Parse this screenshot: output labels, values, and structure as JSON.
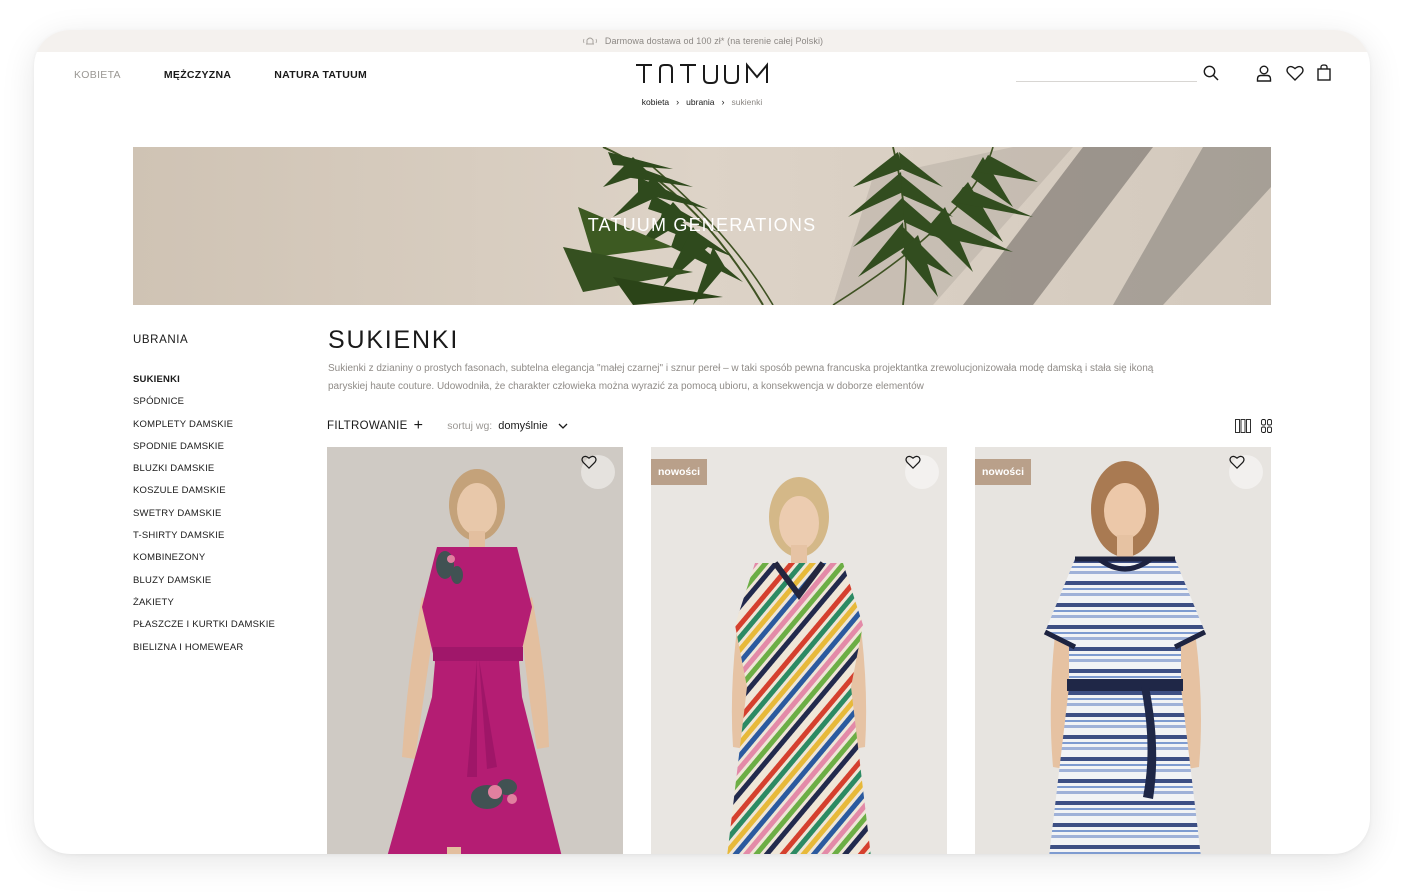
{
  "promo": {
    "text": "Darmowa dostawa od 100 zł* (na terenie całej Polski)",
    "icon": "bell-icon"
  },
  "nav": {
    "items": [
      {
        "label": "KOBIETA",
        "state": "muted"
      },
      {
        "label": "MĘŻCZYZNA"
      },
      {
        "label": "NATURA TATUUM"
      }
    ]
  },
  "brand": {
    "logo_text": "TATUUM"
  },
  "breadcrumb": [
    "kobieta",
    "ubrania",
    "sukienki"
  ],
  "header_icons": [
    "search-icon",
    "user-icon",
    "heart-icon",
    "shopping-bag-icon"
  ],
  "hero": {
    "title": "TATUUM GENERATIONS"
  },
  "sidebar": {
    "heading": "UBRANIA",
    "items": [
      {
        "label": "SUKIENKI",
        "active": true
      },
      {
        "label": "SPÓDNICE"
      },
      {
        "label": "KOMPLETY DAMSKIE"
      },
      {
        "label": "SPODNIE DAMSKIE"
      },
      {
        "label": "BLUZKI DAMSKIE"
      },
      {
        "label": "KOSZULE DAMSKIE"
      },
      {
        "label": "SWETRY DAMSKIE"
      },
      {
        "label": "T-SHIRTY DAMSKIE"
      },
      {
        "label": "KOMBINEZONY"
      },
      {
        "label": "BLUZY DAMSKIE"
      },
      {
        "label": "ŻAKIETY"
      },
      {
        "label": "PŁASZCZE I KURTKI DAMSKIE"
      },
      {
        "label": "BIELIZNA I HOMEWEAR"
      }
    ]
  },
  "main": {
    "title": "SUKIENKI",
    "description": "Sukienki z dzianiny o prostych fasonach, subtelna elegancja \"małej czarnej\" i sznur pereł – w taki sposób pewna francuska projektantka zrewolucjonizowała modę damską i stała się ikoną paryskiej haute couture. Udowodniła, że charakter człowieka można wyrazić za pomocą ubioru, a konsekwencja w doborze elementów",
    "toolbar": {
      "filter_label": "FILTROWANIE",
      "filter_icon": "plus-icon",
      "sort_label": "sortuj wg:",
      "sort_value": "domyślnie",
      "view_icons": [
        "grid-3-columns-icon",
        "grid-2-columns-icon"
      ]
    }
  },
  "products": [
    {
      "badge": "",
      "dress_color": "#b21e72",
      "pattern": "solid-floral"
    },
    {
      "badge": "nowości",
      "dress_color": "#e8dccf",
      "pattern": "diagonal-rainbow-stripes"
    },
    {
      "badge": "nowości",
      "dress_color": "#eef0f3",
      "pattern": "horizontal-blue-stripes"
    }
  ],
  "colors": {
    "badge_bg": "#b9a08a",
    "promo_bg": "#f4f1ee",
    "muted_text": "#9a9793",
    "hero_bg": "#d8cfc3"
  }
}
